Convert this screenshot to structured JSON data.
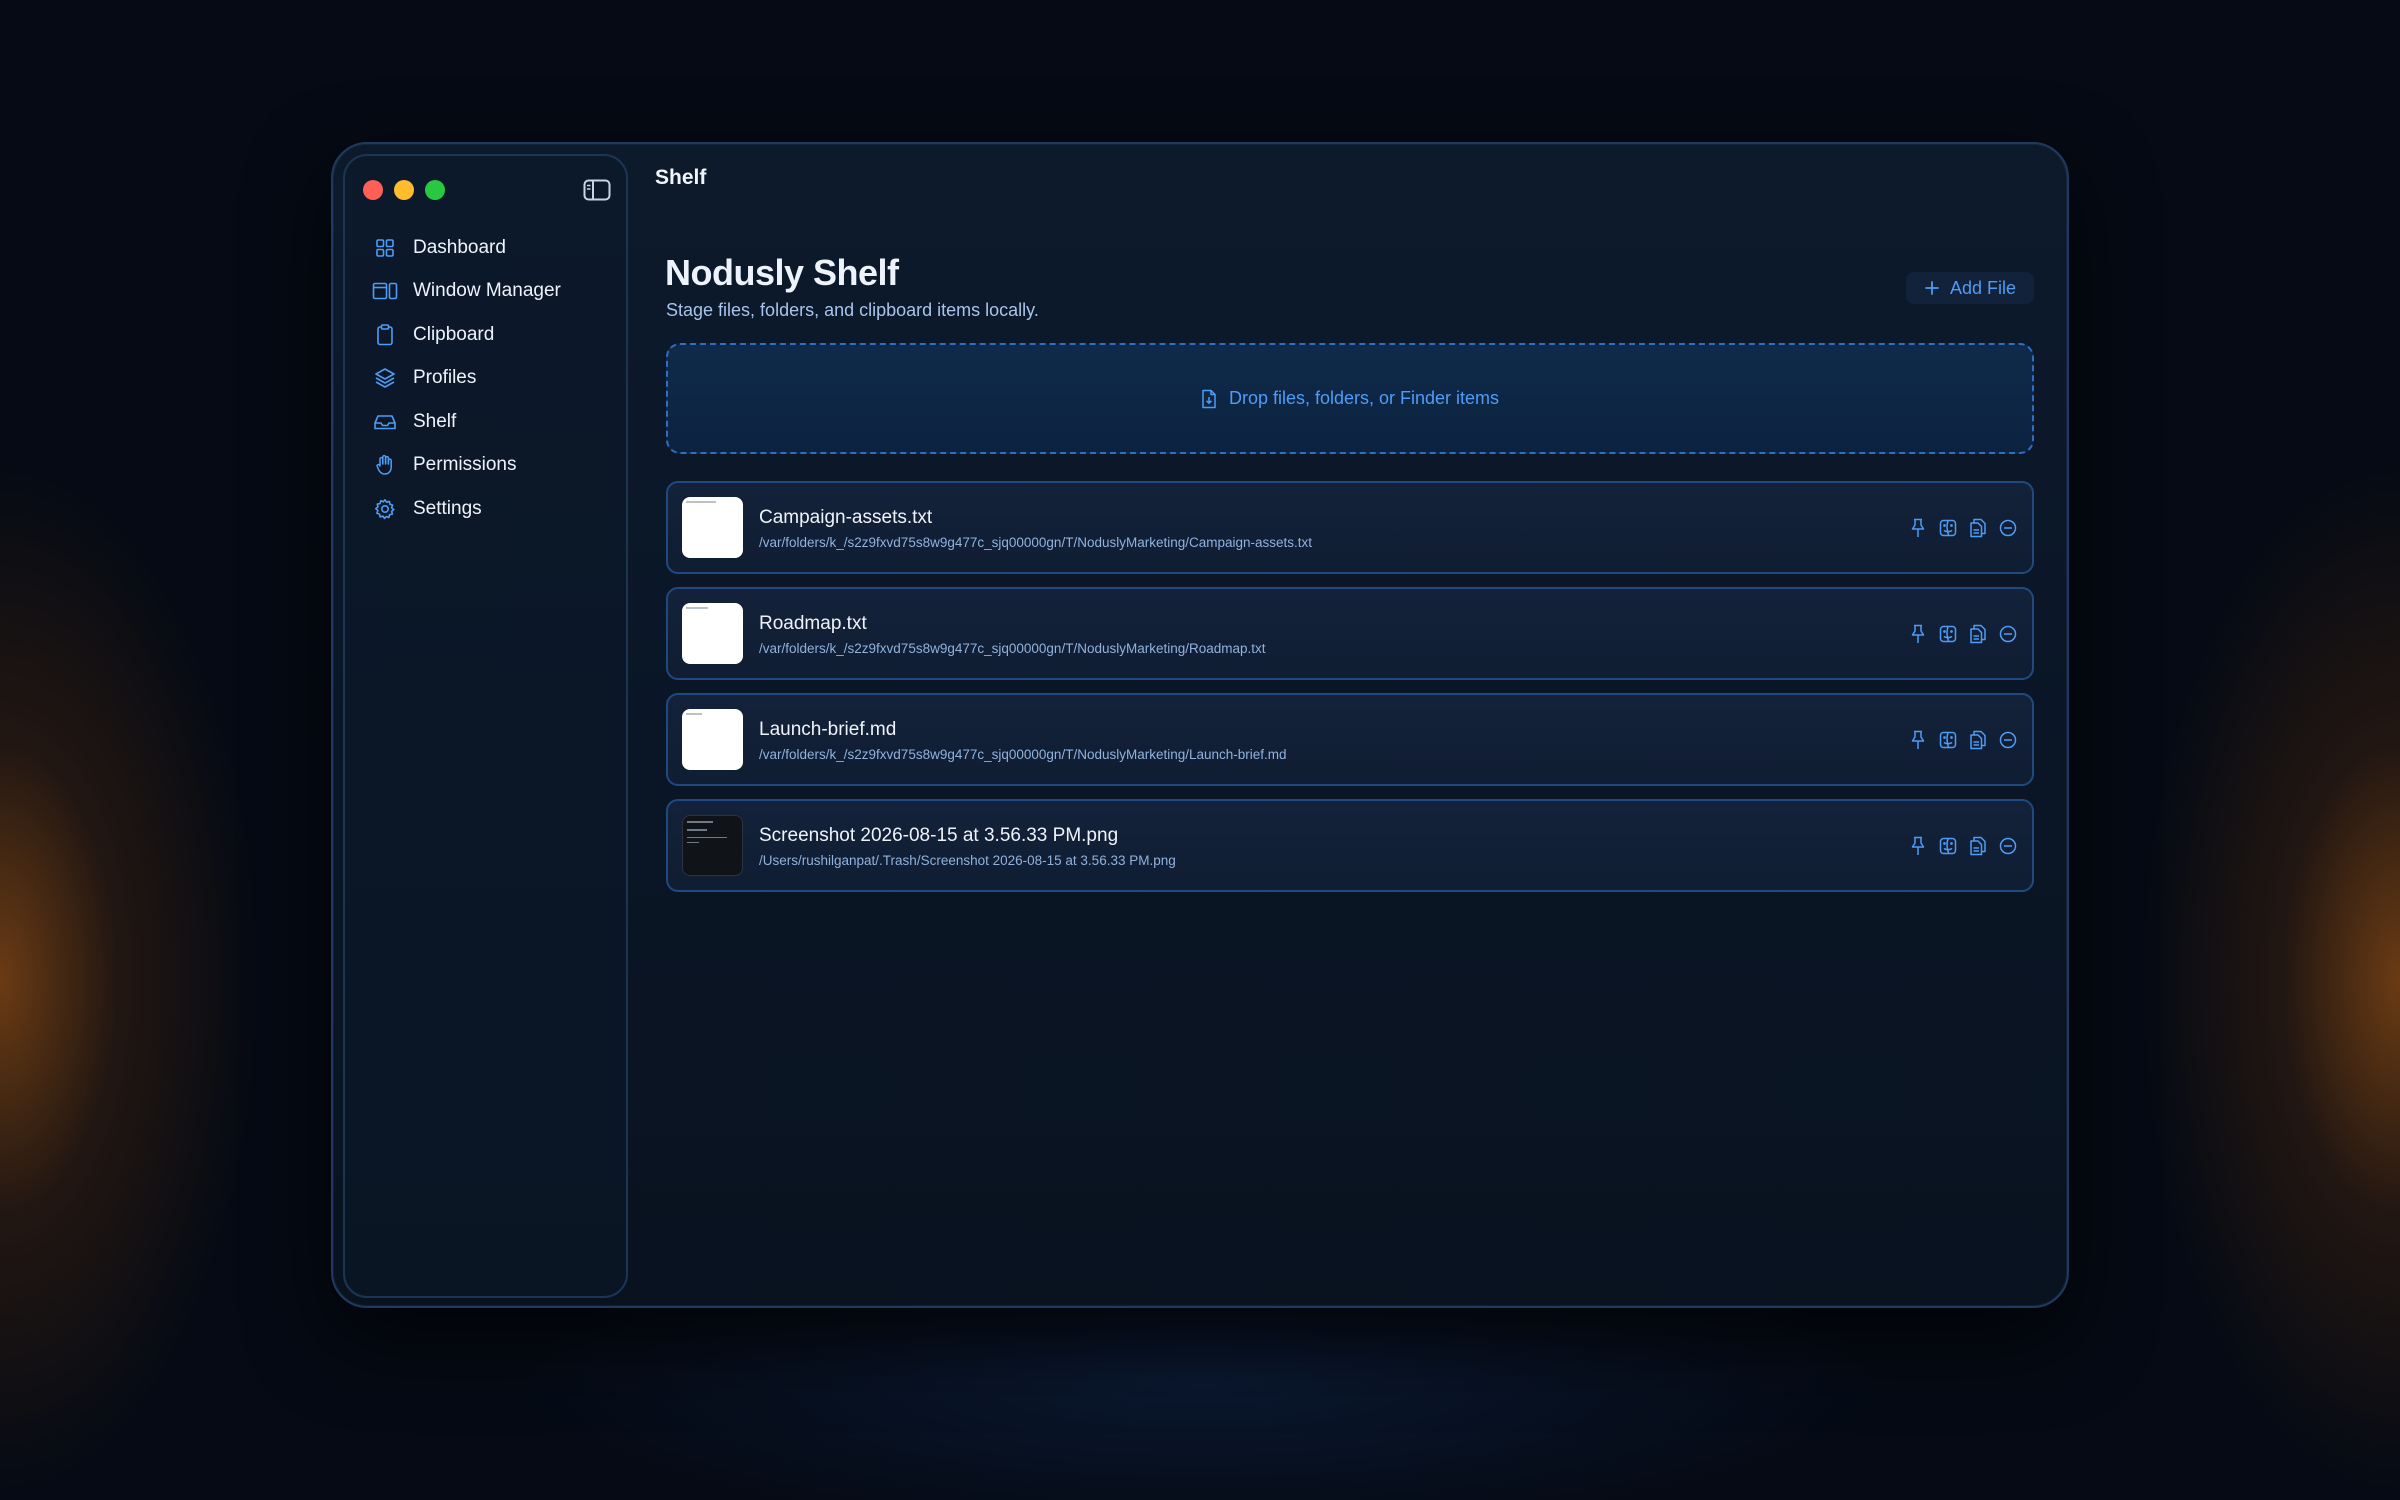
{
  "window": {
    "traffic_lights": [
      "close",
      "minimize",
      "zoom"
    ],
    "sidebar_toggle_icon": "sidebar-toggle-icon"
  },
  "sidebar": {
    "items": [
      {
        "label": "Dashboard",
        "icon": "grid-icon"
      },
      {
        "label": "Window Manager",
        "icon": "windows-icon"
      },
      {
        "label": "Clipboard",
        "icon": "clipboard-icon"
      },
      {
        "label": "Profiles",
        "icon": "layers-icon"
      },
      {
        "label": "Shelf",
        "icon": "tray-icon"
      },
      {
        "label": "Permissions",
        "icon": "hand-icon"
      },
      {
        "label": "Settings",
        "icon": "gear-icon"
      }
    ]
  },
  "header": {
    "title": "Shelf"
  },
  "main": {
    "title": "Nodusly Shelf",
    "subtitle": "Stage files, folders, and clipboard items locally.",
    "add_file_label": "Add File",
    "dropzone_label": "Drop files, folders, or Finder items"
  },
  "files": [
    {
      "name": "Campaign-assets.txt",
      "path": "/var/folders/k_/s2z9fxvd75s8w9g477c_sjq00000gn/T/NoduslyMarketing/Campaign-assets.txt",
      "thumb": "text"
    },
    {
      "name": "Roadmap.txt",
      "path": "/var/folders/k_/s2z9fxvd75s8w9g477c_sjq00000gn/T/NoduslyMarketing/Roadmap.txt",
      "thumb": "text"
    },
    {
      "name": "Launch-brief.md",
      "path": "/var/folders/k_/s2z9fxvd75s8w9g477c_sjq00000gn/T/NoduslyMarketing/Launch-brief.md",
      "thumb": "text"
    },
    {
      "name": "Screenshot 2026-08-15 at 3.56.33 PM.png",
      "path": "/Users/rushilganpat/.Trash/Screenshot 2026-08-15 at 3.56.33 PM.png",
      "thumb": "image"
    }
  ],
  "row_actions": [
    "pin-icon",
    "finder-icon",
    "copy-icon",
    "remove-icon"
  ],
  "colors": {
    "accent": "#4f9cf5",
    "background": "#050a14",
    "window": "#0d1a2c",
    "row_border": "#1f4a80"
  }
}
